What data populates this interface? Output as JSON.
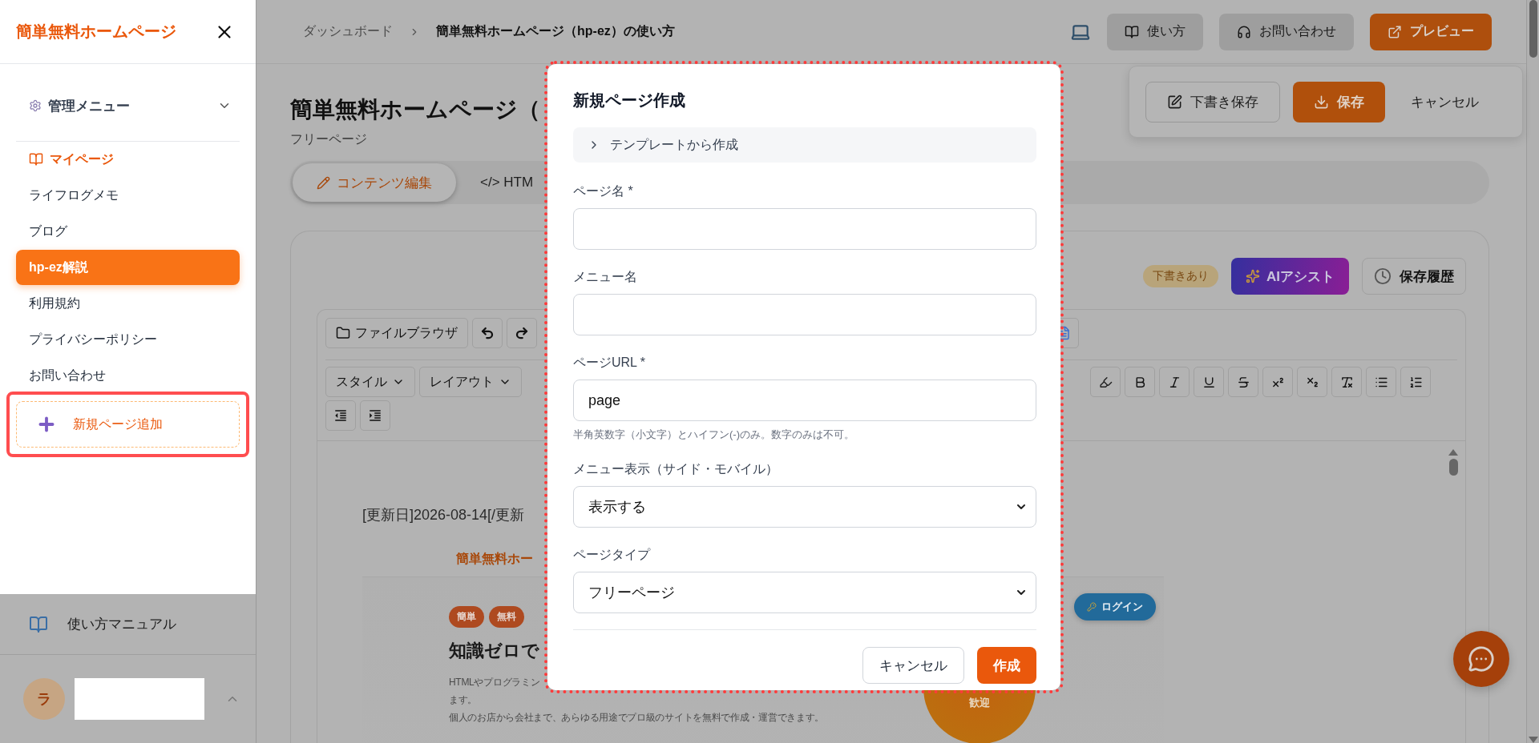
{
  "sidebar": {
    "title": "簡単無料ホームページ",
    "menu_header": "管理メニュー",
    "items": [
      {
        "label": "マイページ",
        "kind": "home",
        "selected": false
      },
      {
        "label": "ライフログメモ",
        "kind": "page",
        "selected": false
      },
      {
        "label": "ブログ",
        "kind": "page",
        "selected": false
      },
      {
        "label": "hp-ez解説",
        "kind": "page",
        "selected": true
      },
      {
        "label": "利用規約",
        "kind": "page",
        "selected": false
      },
      {
        "label": "プライバシーポリシー",
        "kind": "page",
        "selected": false
      },
      {
        "label": "お問い合わせ",
        "kind": "page",
        "selected": false
      }
    ],
    "add_page": {
      "label": "新規ページ追加",
      "highlighted": true
    },
    "manual": "使い方マニュアル",
    "user": {
      "avatar": "ラ"
    }
  },
  "topbar": {
    "breadcrumb": [
      "ダッシュボード",
      "簡単無料ホームページ（hp-ez）の使い方"
    ],
    "buttons": [
      {
        "label": "使い方",
        "kind": "help"
      },
      {
        "label": "お問い合わせ",
        "kind": "contact"
      },
      {
        "label": "プレビュー",
        "kind": "preview"
      }
    ]
  },
  "save_panel": {
    "buttons": [
      {
        "label": "下書き保存",
        "kind": "draft"
      },
      {
        "label": "保存",
        "kind": "save"
      },
      {
        "label": "キャンセル",
        "kind": "cancel"
      }
    ]
  },
  "page": {
    "title": "簡単無料ホームページ（",
    "subtitle": "フリーページ",
    "tabs": [
      {
        "label": "コンテンツ編集",
        "selected": true
      },
      {
        "label": "</> HTM",
        "selected": false
      }
    ]
  },
  "editor": {
    "badge": "下書きあり",
    "ai_button": "AIアシスト",
    "history_button": "保存履歴",
    "file_browser": "ファイルブラウザ",
    "dropdowns": [
      "スタイル",
      "レイアウト"
    ],
    "date_line": "[更新日]2026-08-14[/更新",
    "preview": {
      "site_title": "簡単無料ホー",
      "tags": [
        "簡単",
        "無料"
      ],
      "heading": "知識ゼロで",
      "lines": [
        "HTMLやプログラミン",
        "ます。",
        "個人のお店から会社まで、あらゆる用途でプロ級のサイトを無料で作成・運営できます。"
      ],
      "login": "ログイン",
      "circle": "歓迎"
    }
  },
  "modal": {
    "title": "新規ページ作成",
    "highlighted": true,
    "template_toggle": "テンプレートから作成",
    "fields": [
      {
        "label": "ページ名 *",
        "kind": "text"
      },
      {
        "label": "メニュー名",
        "kind": "text"
      },
      {
        "label": "ページURL *",
        "kind": "text",
        "value": "page",
        "hint": "半角英数字（小文字）とハイフン(-)のみ。数字のみは不可。"
      },
      {
        "label": "メニュー表示（サイド・モバイル）",
        "kind": "select",
        "value": "表示する"
      },
      {
        "label": "ページタイプ",
        "kind": "select",
        "value": "フリーページ"
      }
    ],
    "buttons": [
      {
        "label": "キャンセル",
        "kind": "cancel"
      },
      {
        "label": "作成",
        "kind": "primary"
      }
    ]
  }
}
